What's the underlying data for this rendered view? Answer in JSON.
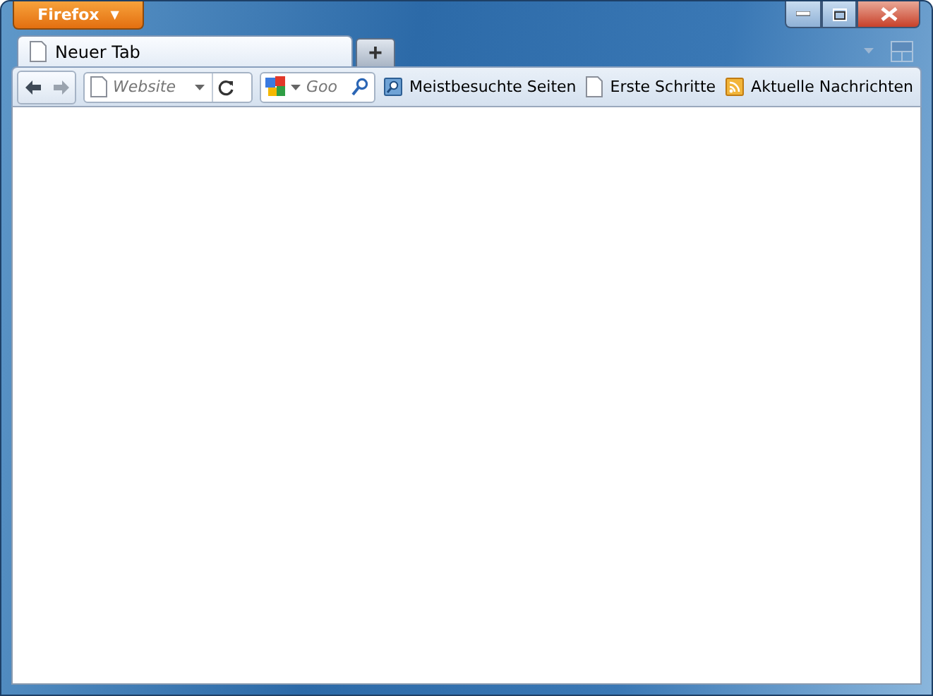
{
  "app_menu": {
    "label": "Firefox",
    "arrow": "▼"
  },
  "tabs": [
    {
      "title": "Neuer Tab",
      "selected": true
    }
  ],
  "new_tab": {
    "label": "+"
  },
  "address_bar": {
    "placeholder": "Website"
  },
  "search_bar": {
    "placeholder": "Goo"
  },
  "bookmarks": [
    {
      "label": "Meistbesuchte Seiten",
      "kind": "smart"
    },
    {
      "label": "Erste Schritte",
      "kind": "page"
    },
    {
      "label": "Aktuelle Nachrichten",
      "kind": "feed"
    }
  ]
}
